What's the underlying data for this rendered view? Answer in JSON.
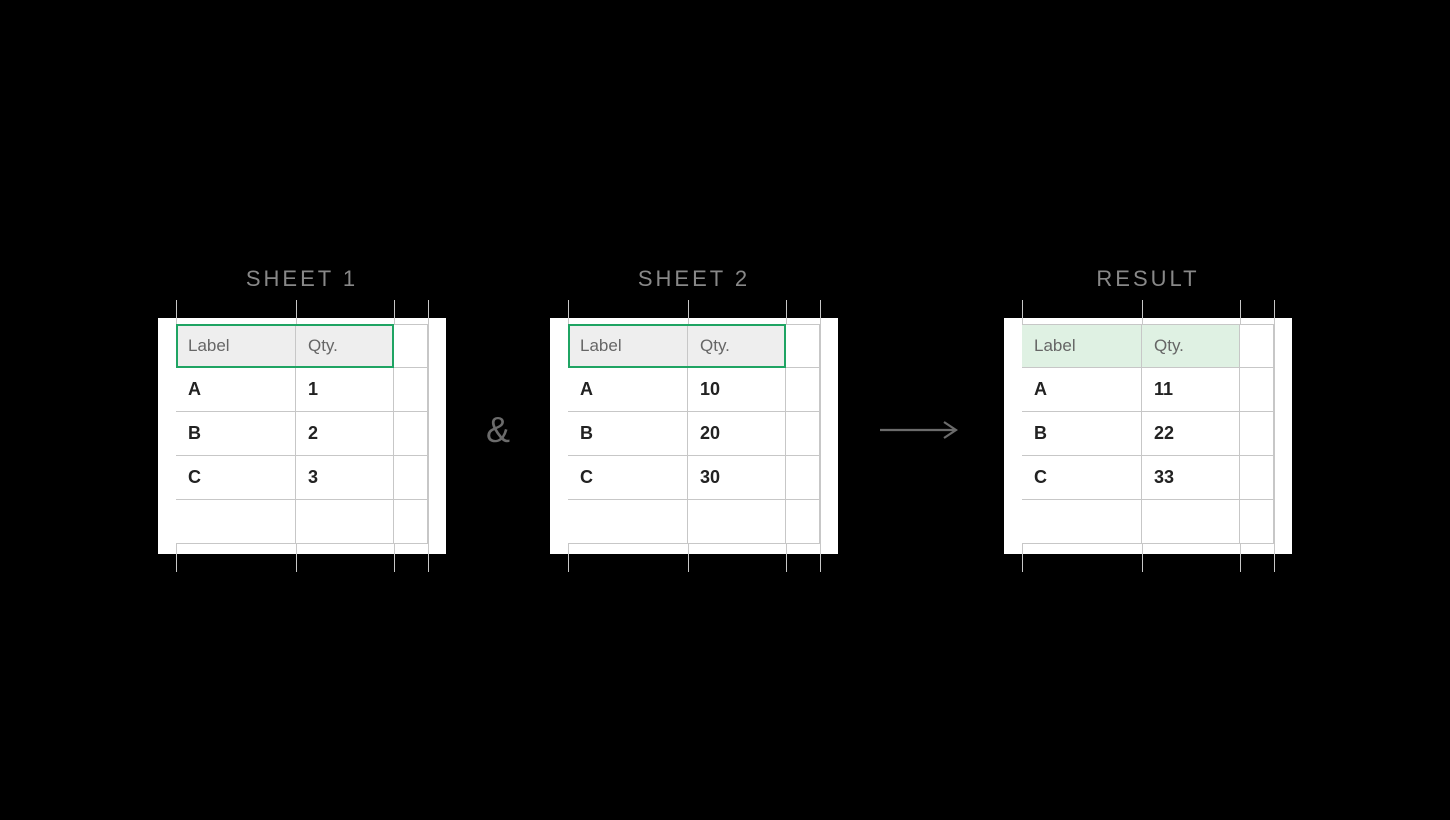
{
  "accent_green": "#1fa463",
  "result_header_fill": "#dff1e3",
  "tables": {
    "sheet1": {
      "title": "SHEET 1",
      "headers": [
        "Label",
        "Qty."
      ],
      "rows": [
        {
          "label": "A",
          "qty": "1"
        },
        {
          "label": "B",
          "qty": "2"
        },
        {
          "label": "C",
          "qty": "3"
        }
      ]
    },
    "sheet2": {
      "title": "SHEET 2",
      "headers": [
        "Label",
        "Qty."
      ],
      "rows": [
        {
          "label": "A",
          "qty": "10"
        },
        {
          "label": "B",
          "qty": "20"
        },
        {
          "label": "C",
          "qty": "30"
        }
      ]
    },
    "result": {
      "title": "RESULT",
      "headers": [
        "Label",
        "Qty."
      ],
      "rows": [
        {
          "label": "A",
          "qty": "11"
        },
        {
          "label": "B",
          "qty": "22"
        },
        {
          "label": "C",
          "qty": "33"
        }
      ]
    }
  },
  "connectors": {
    "ampersand": "&",
    "arrow": "→"
  }
}
